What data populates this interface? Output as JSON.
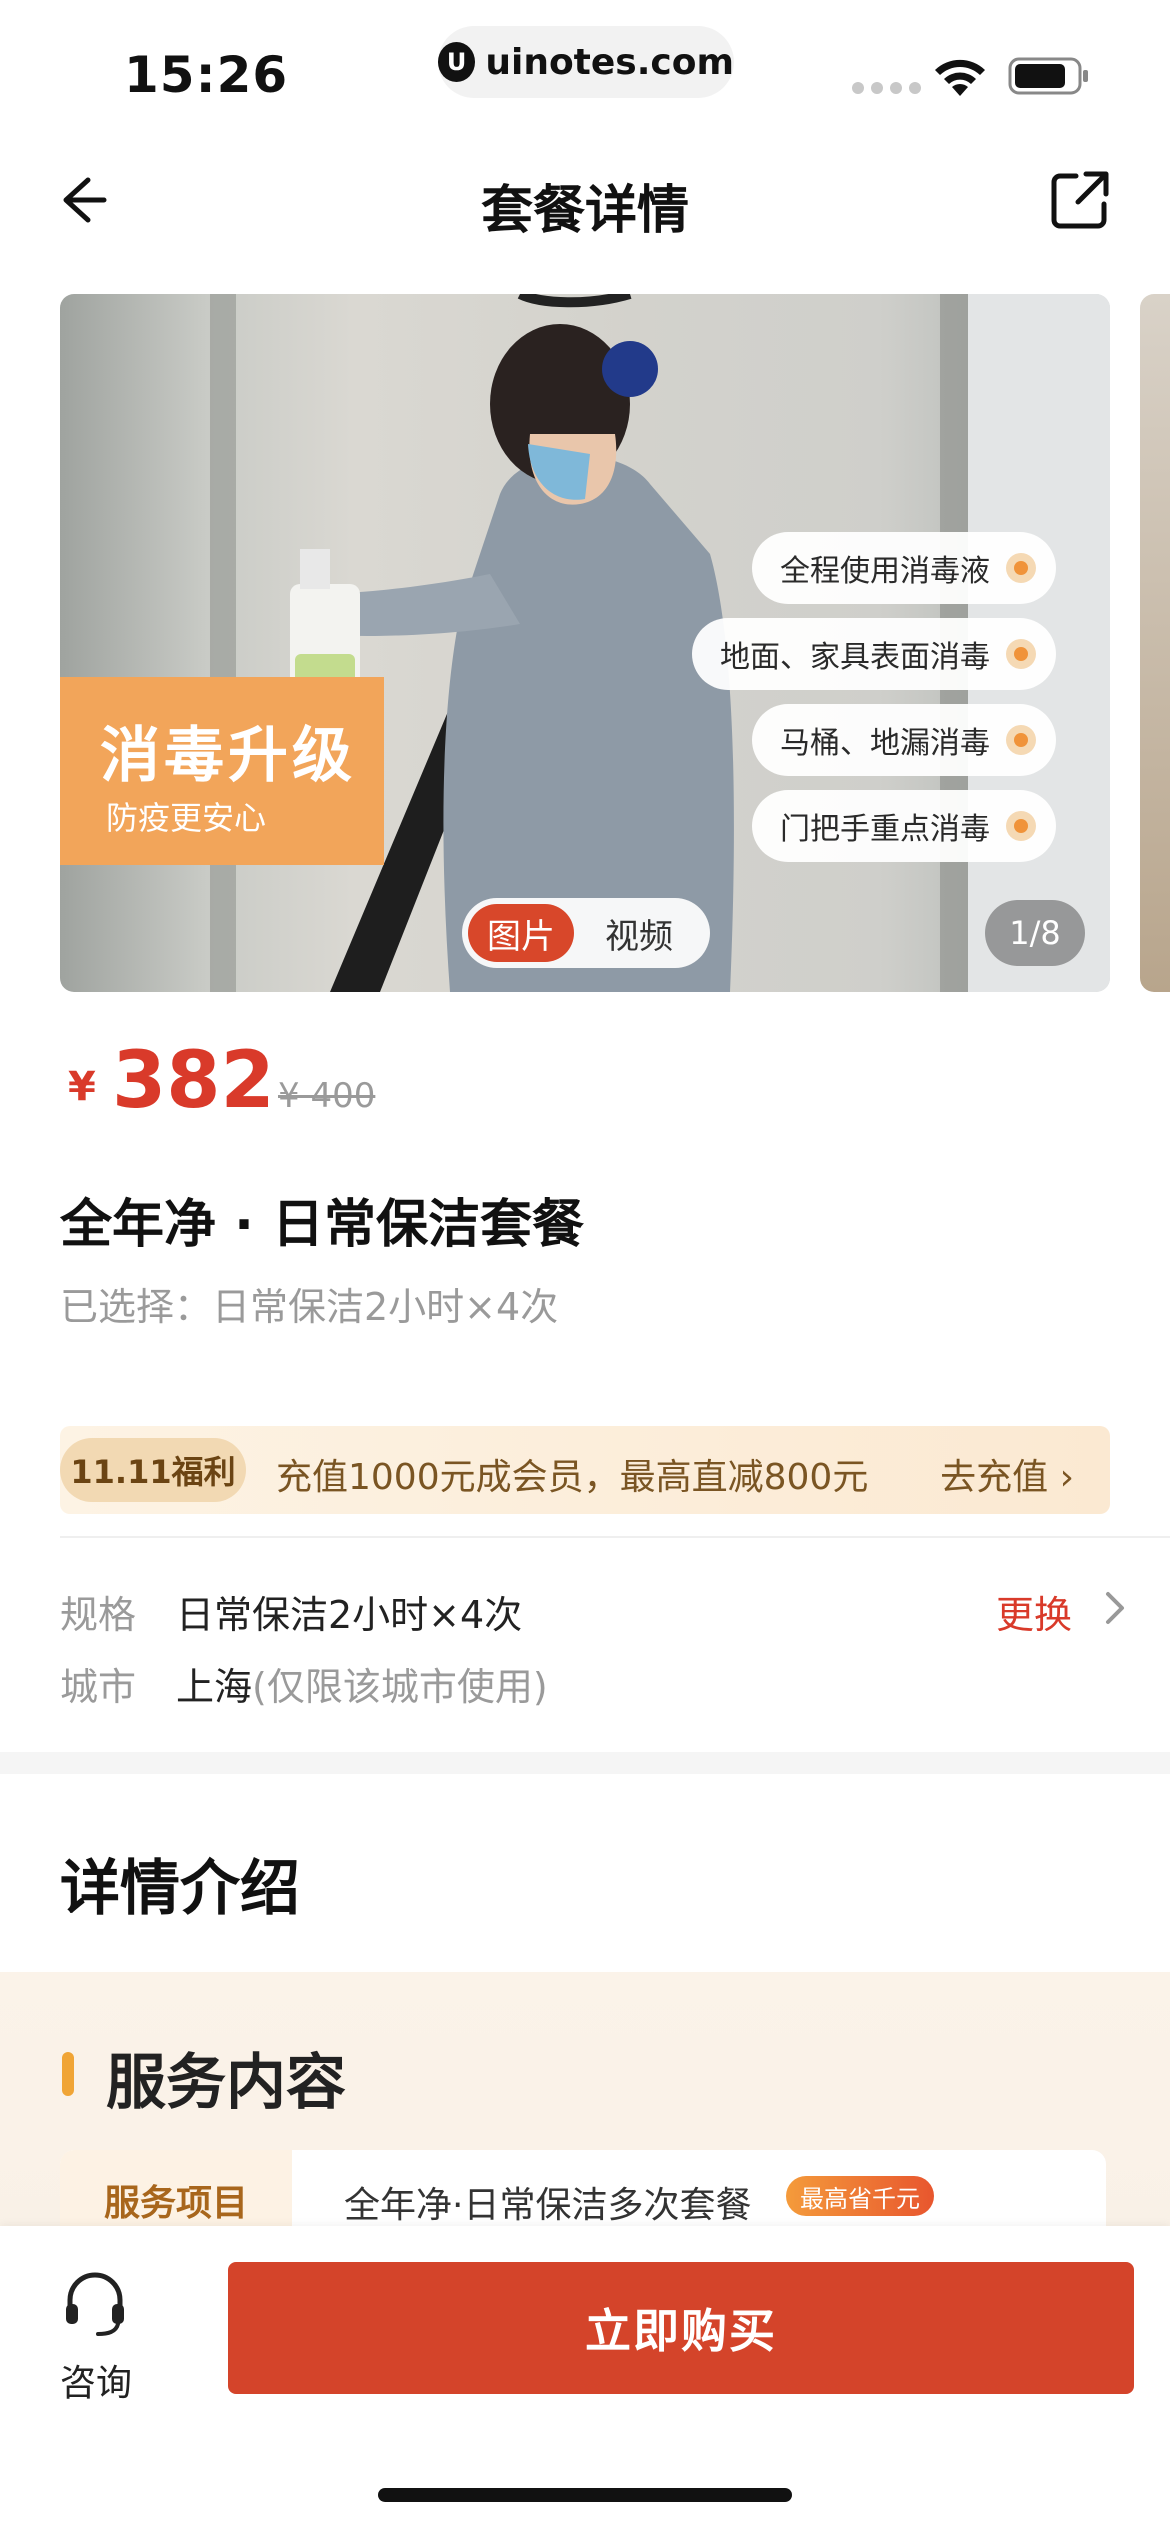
{
  "status_bar": {
    "time": "15:26",
    "url": "uinotes.com",
    "url_logo": "U"
  },
  "nav": {
    "title": "套餐详情",
    "back_icon": "arrow-left-icon",
    "share_icon": "share-icon"
  },
  "banner": {
    "promo_title": "消毒升级",
    "promo_subtitle": "防疫更安心",
    "tags": [
      "全程使用消毒液",
      "地面、家具表面消毒",
      "马桶、地漏消毒",
      "门把手重点消毒"
    ],
    "media_toggle": {
      "active": "图片",
      "other": "视频"
    },
    "counter": "1/8"
  },
  "price": {
    "symbol": "¥",
    "current": "382",
    "original": "¥ 400"
  },
  "product": {
    "title": "全年净 · 日常保洁套餐",
    "selected": "已选择：日常保洁2小时×4次"
  },
  "member_promo": {
    "badge": "11.11福利",
    "text": "充值1000元成会员，最高直减800元",
    "action": "去充值 ›"
  },
  "specs": {
    "spec_label": "规格",
    "spec_value": "日常保洁2小时×4次",
    "change": "更换",
    "city_label": "城市",
    "city_value": "上海",
    "city_note": "(仅限该城市使用)"
  },
  "details": {
    "title": "详情介绍"
  },
  "service": {
    "title": "服务内容",
    "row_label": "服务项目",
    "row_value": "全年净·日常保洁多次套餐",
    "row_badge": "最高省千元"
  },
  "bottom_bar": {
    "consult_label": "咨询",
    "buy_label": "立即购买"
  },
  "colors": {
    "accent_red": "#d4442a",
    "price_red": "#d93a2a",
    "promo_orange": "#f2a55a",
    "service_bar": "#f0a536"
  }
}
